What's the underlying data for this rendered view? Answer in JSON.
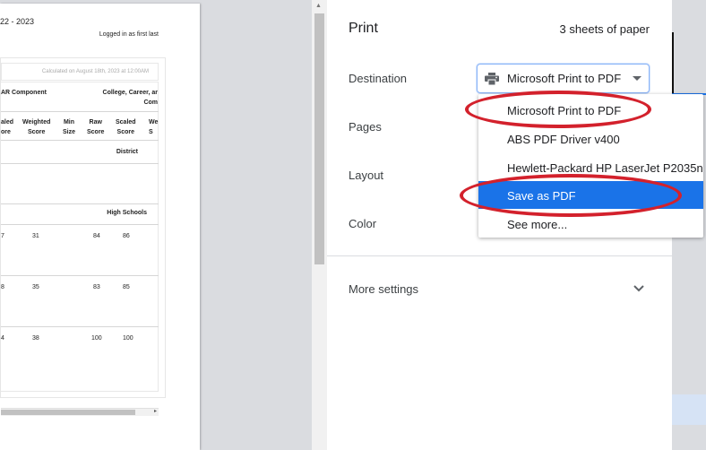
{
  "preview": {
    "year": "22 - 2023",
    "logged_in": "Logged in as first last",
    "calculated": "Calculated on August 18th, 2023 at 12:00AM",
    "header_left": "AR Component",
    "header_right_1": "College, Career, ar",
    "header_right_2": "Com",
    "columns": [
      "aled\nore",
      "Weighted\nScore",
      "Min\nSize",
      "Raw\nScore",
      "Scaled\nScore",
      "We\nS"
    ],
    "section_district": "District",
    "section_high_schools": "High Schools",
    "rows": [
      [
        "7",
        "31",
        "84",
        "86"
      ],
      [
        "8",
        "35",
        "83",
        "85"
      ],
      [
        "4",
        "38",
        "100",
        "100"
      ]
    ]
  },
  "panel": {
    "title": "Print",
    "sheets": "3 sheets of paper",
    "destination_label": "Destination",
    "destination_value": "Microsoft Print to PDF",
    "pages_label": "Pages",
    "layout_label": "Layout",
    "color_label": "Color",
    "more_settings": "More settings"
  },
  "dropdown": {
    "options": [
      "Microsoft Print to PDF",
      "ABS PDF Driver v400",
      "Hewlett-Packard HP LaserJet P2035n",
      "Save as PDF",
      "See more..."
    ],
    "highlighted_index": 3
  },
  "colors": {
    "highlight": "#1a73e8",
    "annotation": "#d3212c"
  }
}
